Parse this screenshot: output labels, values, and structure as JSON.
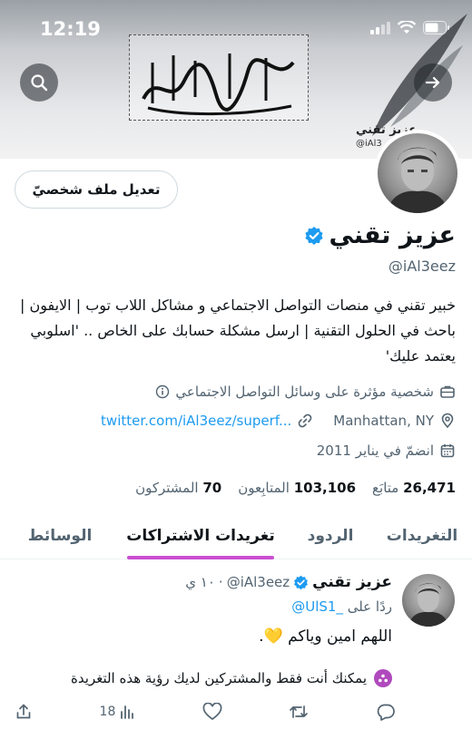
{
  "status": {
    "time": "12:19"
  },
  "banner": {
    "watermark_name": "عزيز تقني",
    "watermark_handle": "@iAl3"
  },
  "profile": {
    "edit_label": "تعديل ملف شخصيّ",
    "name": "عزيز تقني",
    "handle": "@iAl3eez",
    "bio": "خبير تقني في منصات التواصل الاجتماعي و مشاكل اللاب توب | الايفون | باحث في الحلول التقنية | ارسل مشكلة حسابك على الخاص .. 'اسلوبي يعتمد عليك'",
    "category": "شخصية مؤثرة على وسائل التواصل الاجتماعي",
    "location": "Manhattan, NY",
    "website": "twitter.com/iAl3eez/superf...",
    "joined": "انضمّ في يناير 2011",
    "following_count": "26,471",
    "following_label": "متابَع",
    "followers_count": "103,106",
    "followers_label": "المتابِعون",
    "subscribers_count": "70",
    "subscribers_label": "المشتركون"
  },
  "tabs": [
    {
      "label": "التغريدات"
    },
    {
      "label": "الردود"
    },
    {
      "label": "تغريدات الاشتراكات"
    },
    {
      "label": "الوسائط"
    }
  ],
  "active_tab": 2,
  "tweet": {
    "name": "عزيز تقني",
    "handle": "@iAl3eez",
    "time": "١٠ ي",
    "reply_prefix": "ردًا على",
    "reply_to": "@UlS1_",
    "text": "اللهم امين وياكم 💛.",
    "subscriber_note": "يمكنك أنت فقط والمشتركين لديك رؤية هذه التغريدة",
    "views": "18"
  },
  "colors": {
    "accent": "#c94fd1",
    "link": "#1d9bf0",
    "verified": "#1d9bf0"
  }
}
